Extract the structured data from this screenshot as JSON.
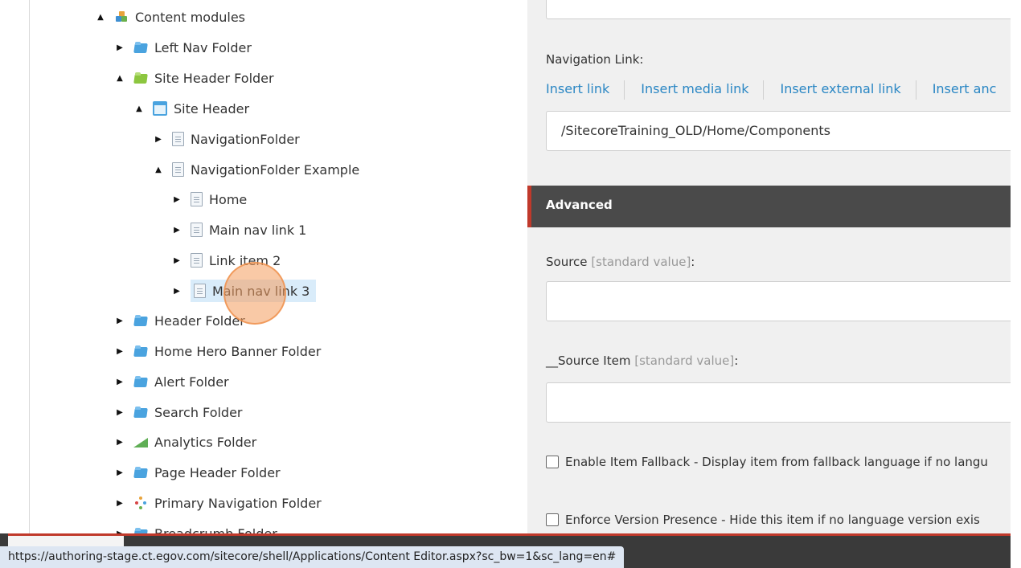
{
  "tree": {
    "nodes": [
      {
        "label": "Content modules",
        "icon": "modules-icon",
        "toggle": "▲"
      },
      {
        "label": "Left Nav Folder",
        "icon": "folder-icon",
        "toggle": "▶"
      },
      {
        "label": "Site Header Folder",
        "icon": "green-folder-icon",
        "toggle": "▲"
      },
      {
        "label": "Site Header",
        "icon": "window-icon",
        "toggle": "▲"
      },
      {
        "label": "NavigationFolder",
        "icon": "page-icon",
        "toggle": "▶"
      },
      {
        "label": "NavigationFolder Example",
        "icon": "page-icon",
        "toggle": "▲"
      },
      {
        "label": "Home",
        "icon": "page-icon",
        "toggle": "▶"
      },
      {
        "label": "Main nav link 1",
        "icon": "page-icon",
        "toggle": "▶"
      },
      {
        "label": "Link item 2",
        "icon": "page-icon",
        "toggle": "▶"
      },
      {
        "label": "Main nav link 3",
        "icon": "page-icon",
        "toggle": "▶"
      },
      {
        "label": "Header Folder",
        "icon": "folder-icon",
        "toggle": "▶"
      },
      {
        "label": "Home Hero Banner Folder",
        "icon": "folder-icon",
        "toggle": "▶"
      },
      {
        "label": "Alert Folder",
        "icon": "folder-icon",
        "toggle": "▶"
      },
      {
        "label": "Search Folder",
        "icon": "folder-icon",
        "toggle": "▶"
      },
      {
        "label": "Analytics Folder",
        "icon": "chart-icon",
        "toggle": "▶"
      },
      {
        "label": "Page Header Folder",
        "icon": "folder-icon",
        "toggle": "▶"
      },
      {
        "label": "Primary Navigation Folder",
        "icon": "tree-icon",
        "toggle": "▶"
      },
      {
        "label": "Breadcrumb Folder",
        "icon": "folder-icon",
        "toggle": "▶"
      }
    ]
  },
  "panel": {
    "navigation_link_label": "Navigation Link:",
    "insert_links": [
      "Insert link",
      "Insert media link",
      "Insert external link",
      "Insert anc"
    ],
    "navigation_link_value": "/SitecoreTraining_OLD/Home/Components",
    "section_title": "Advanced",
    "source_label": "Source",
    "source_std": "[standard value]",
    "source_colon": ":",
    "source_item_label": "__Source Item",
    "source_item_std": "[standard value]",
    "source_item_colon": ":",
    "enable_fallback": "Enable Item Fallback - Display item from fallback language if no langu",
    "enforce_version": "Enforce Version Presence - Hide this item if no language version exis"
  },
  "status": {
    "url": "https://authoring-stage.ct.egov.com/sitecore/shell/Applications/Content Editor.aspx?sc_bw=1&sc_lang=en#"
  },
  "colors": {
    "accent": "#2b87c4",
    "section_bar": "#c0392b",
    "selection": "#d9ecfa"
  }
}
